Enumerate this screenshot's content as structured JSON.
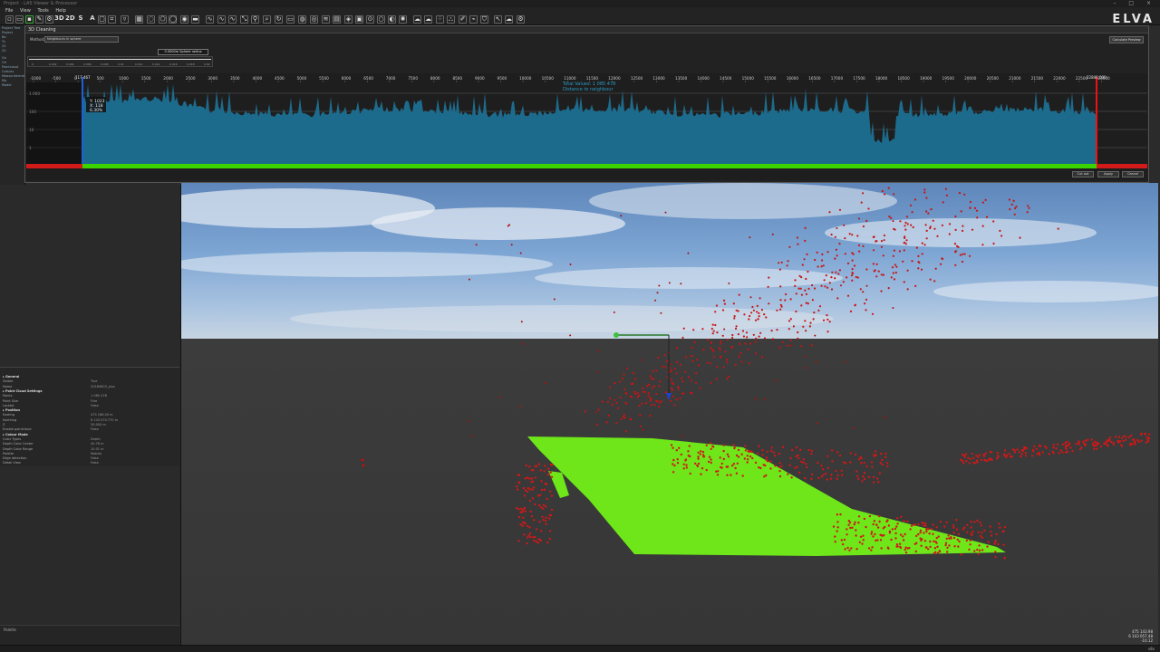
{
  "app": {
    "title": "Project - LAS Viewer & Processor",
    "logo": "ELVA"
  },
  "window_controls": "– □ ×",
  "menu": [
    "File",
    "View",
    "Tools",
    "Help"
  ],
  "toolbar": {
    "view_3d_label": "3D",
    "view_2d_label": "2D",
    "s_label": "S",
    "a_label": "A"
  },
  "project_tree": {
    "items": [
      "Project Tree",
      "Project",
      "Ba",
      "Tu",
      "20",
      "20",
      "Ge",
      "Ori",
      "Pointcloud",
      "Colours",
      "Measurements",
      "Mo",
      "Model"
    ]
  },
  "dialog": {
    "title": "3D Cleaning",
    "method_label": "Method:",
    "method_value": "Neighbours in sphere",
    "radius_value": "0.5000m Sphere radius",
    "calculate_label": "Calculate Preview",
    "total_values": "Total Values: 1 085 478",
    "distance_label": "Distance to neighbour",
    "tooltip": {
      "y": "Y: 1023",
      "x": "X: 118",
      "pct": "6.30%"
    },
    "marker_left": "117.467",
    "marker_right": "22846.000",
    "cut_out": "Cut out",
    "apply": "Apply",
    "cancel": "Cancel",
    "slider_ticks": [
      "0",
      "0.002",
      "0.004",
      "0.006",
      "0.008",
      "0.01",
      "0.012",
      "0.014",
      "0.016",
      "0.018",
      "0.02"
    ]
  },
  "histogram": {
    "x_ticks": [
      "-1000",
      "-500",
      "0",
      "500",
      "1000",
      "1500",
      "2000",
      "2500",
      "3000",
      "3500",
      "4000",
      "4500",
      "5000",
      "5500",
      "6000",
      "6500",
      "7000",
      "7500",
      "8000",
      "8500",
      "9000",
      "9500",
      "10000",
      "10500",
      "11000",
      "11500",
      "12000",
      "12500",
      "13000",
      "13500",
      "14000",
      "14500",
      "15000",
      "15500",
      "16000",
      "16500",
      "17000",
      "17500",
      "18000",
      "18500",
      "19000",
      "19500",
      "20000",
      "20500",
      "21000",
      "21500",
      "22000",
      "22500",
      "23000"
    ],
    "y_ticks": [
      "1 000",
      "100",
      "10",
      "1"
    ],
    "range_cut": [
      117.467,
      22846.0
    ],
    "colors": {
      "bar": "#1d6b8c",
      "keep": "#3cd400",
      "cut": "#d11a1a"
    }
  },
  "properties": {
    "rows": [
      {
        "label": "General",
        "value": "",
        "header": true
      },
      {
        "label": "Visible",
        "value": "True"
      },
      {
        "label": "Name",
        "value": "20180603_plus"
      },
      {
        "label": "Point Cloud Settings",
        "value": "",
        "header": true
      },
      {
        "label": "Points",
        "value": "1 085 478"
      },
      {
        "label": "Point Size",
        "value": "Fine"
      },
      {
        "label": "Locked",
        "value": "False"
      },
      {
        "label": "Position",
        "value": "",
        "header": true
      },
      {
        "label": "Easting",
        "value": "475 166.00 m"
      },
      {
        "label": "Northing",
        "value": "6 143 070.770 m"
      },
      {
        "label": "Z",
        "value": "30.000 m"
      },
      {
        "label": "Enable pointcloud",
        "value": "False"
      },
      {
        "label": "Colour Mode",
        "value": "",
        "header": true
      },
      {
        "label": "Color Types",
        "value": "Depth"
      },
      {
        "label": "Depth Color Center",
        "value": "40.76 m"
      },
      {
        "label": "Depth Color Range",
        "value": "10.01 m"
      },
      {
        "label": "Palette",
        "value": "Matlab"
      },
      {
        "label": "Edge detection",
        "value": "False"
      },
      {
        "label": "Detail View",
        "value": "False"
      }
    ]
  },
  "lower_panel_label": "Palette",
  "viewport": {
    "coords": [
      "475 143.98",
      "6 143 057.48",
      "-10.12"
    ],
    "colors": {
      "kept": "#6ee619",
      "removed": "#cc1a1a"
    }
  },
  "status": "v8x"
}
